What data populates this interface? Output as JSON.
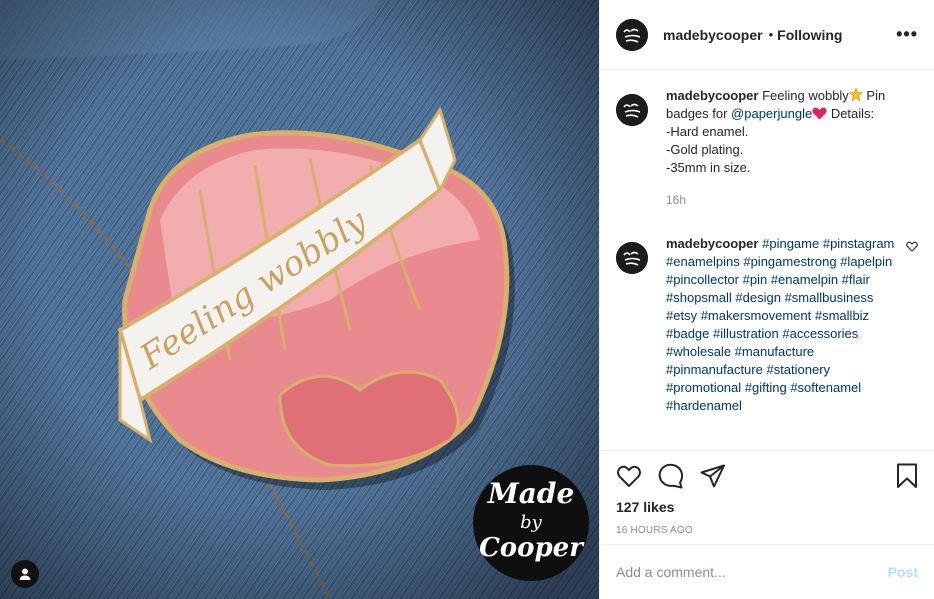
{
  "header": {
    "username": "madebycooper",
    "separator": "•",
    "follow_status": "Following",
    "more_icon": "more-horizontal-icon"
  },
  "photo": {
    "banner_text": "Feeling wobbly",
    "logo_text": [
      "Made",
      "by",
      "Cooper"
    ]
  },
  "caption": {
    "username": "madebycooper",
    "text_1": " Feeling wobbly",
    "text_2": " Pin badges for ",
    "mention": "@paperjungle",
    "text_3": " Details:",
    "lines": [
      "-Hard enamel.",
      "-Gold plating.",
      "-35mm in size."
    ],
    "time": "16h"
  },
  "hashtag_comment": {
    "username": "madebycooper",
    "tags": [
      "#pingame",
      "#pinstagram",
      "#enamelpins",
      "#pingamestrong",
      "#lapelpin",
      "#pincollector",
      "#pin",
      "#enamelpin",
      "#flair",
      "#shopsmall",
      "#design",
      "#smallbusiness",
      "#etsy",
      "#makersmovement",
      "#smallbiz",
      "#badge",
      "#illustration",
      "#accessories",
      "#wholesale",
      "#manufacture",
      "#pinmanufacture",
      "#stationery",
      "#promotional",
      "#gifting",
      "#softenamel",
      "#hardenamel"
    ]
  },
  "actions": {
    "likes": "127 likes",
    "time_ago": "16 HOURS AGO"
  },
  "comment_box": {
    "placeholder": "Add a comment...",
    "post_label": "Post"
  },
  "colors": {
    "link": "#00376b",
    "muted": "#8e8e8e",
    "post_disabled": "#b2dffc"
  }
}
